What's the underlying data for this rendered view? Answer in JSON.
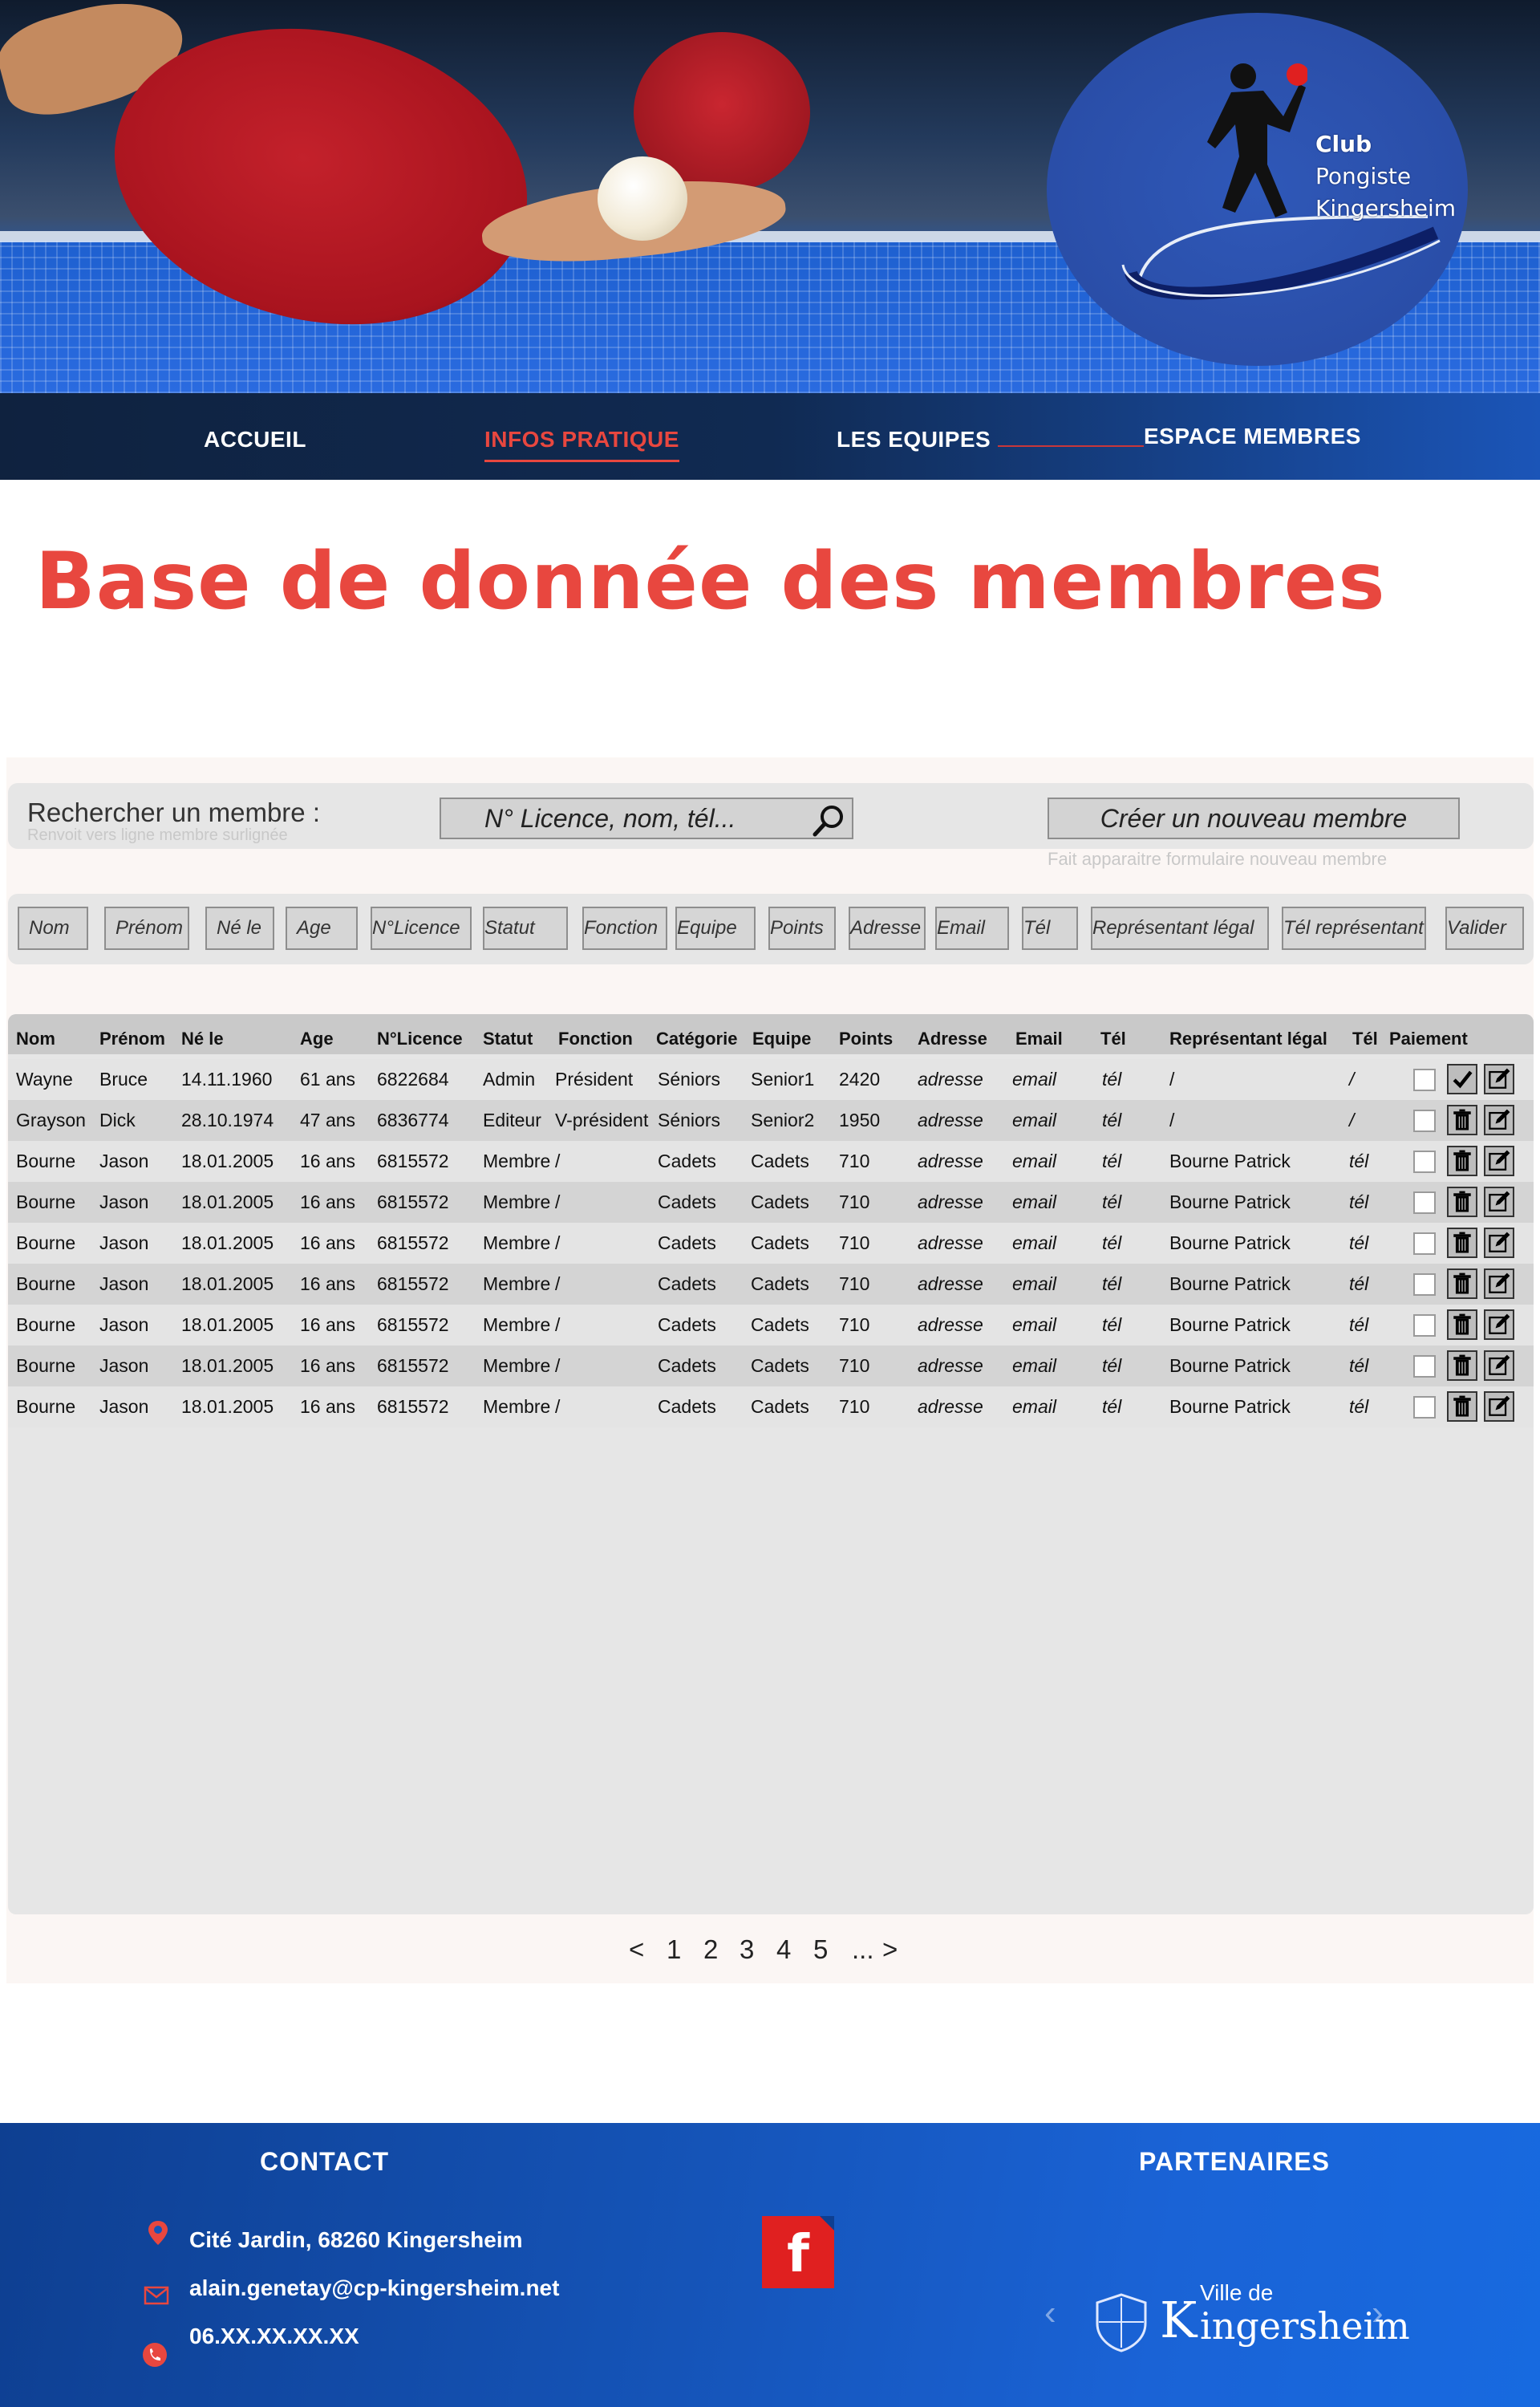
{
  "header": {
    "logo_lines": [
      "Club",
      "Pongiste",
      "Kingersheim"
    ]
  },
  "nav": {
    "items": [
      {
        "label": "ACCUEIL",
        "active": false
      },
      {
        "label": "INFOS PRATIQUE",
        "active": true
      },
      {
        "label": "LES EQUIPES",
        "active": false
      },
      {
        "label": "ESPACE MEMBRES",
        "active": false
      }
    ]
  },
  "page": {
    "title": "Base de donnée des membres"
  },
  "search": {
    "label": "Rechercher un membre :",
    "hint": "Renvoit vers ligne membre surlignée",
    "placeholder": "N° Licence, nom, tél...",
    "create_label": "Créer un nouveau membre",
    "create_hint": "Fait apparaitre formulaire nouveau membre"
  },
  "filters": [
    "Nom",
    "Prénom",
    "Né le",
    "Age",
    "N°Licence",
    "Statut",
    "Fonction",
    "Equipe",
    "Points",
    "Adresse",
    "Email",
    "Tél",
    "Représentant légal",
    "Tél représentant",
    "Valider"
  ],
  "table": {
    "headers": [
      "Nom",
      "Prénom",
      "Né le",
      "Age",
      "N°Licence",
      "Statut",
      "Fonction",
      "Catégorie",
      "Equipe",
      "Points",
      "Adresse",
      "Email",
      "Tél",
      "Représentant légal",
      "Tél",
      "Paiement"
    ],
    "rows": [
      {
        "nom": "Wayne",
        "prenom": "Bruce",
        "ne_le": "14.11.1960",
        "age": "61 ans",
        "licence": "6822684",
        "statut": "Admin",
        "fonction": "Président",
        "categorie": "Séniors",
        "equipe": "Senior1",
        "points": "2420",
        "adresse": "adresse",
        "email": "email",
        "tel": "tél",
        "representant": "/",
        "tel_rep": "/",
        "first_action": "check"
      },
      {
        "nom": "Grayson",
        "prenom": "Dick",
        "ne_le": "28.10.1974",
        "age": "47 ans",
        "licence": "6836774",
        "statut": "Editeur",
        "fonction": "V-président",
        "categorie": "Séniors",
        "equipe": "Senior2",
        "points": "1950",
        "adresse": "adresse",
        "email": "email",
        "tel": "tél",
        "representant": "/",
        "tel_rep": "/",
        "first_action": "trash"
      },
      {
        "nom": "Bourne",
        "prenom": "Jason",
        "ne_le": "18.01.2005",
        "age": "16 ans",
        "licence": "6815572",
        "statut": "Membre",
        "fonction": "/",
        "categorie": "Cadets",
        "equipe": "Cadets",
        "points": "710",
        "adresse": "adresse",
        "email": "email",
        "tel": "tél",
        "representant": "Bourne Patrick",
        "tel_rep": "tél",
        "first_action": "trash"
      },
      {
        "nom": "Bourne",
        "prenom": "Jason",
        "ne_le": "18.01.2005",
        "age": "16 ans",
        "licence": "6815572",
        "statut": "Membre",
        "fonction": "/",
        "categorie": "Cadets",
        "equipe": "Cadets",
        "points": "710",
        "adresse": "adresse",
        "email": "email",
        "tel": "tél",
        "representant": "Bourne Patrick",
        "tel_rep": "tél",
        "first_action": "trash"
      },
      {
        "nom": "Bourne",
        "prenom": "Jason",
        "ne_le": "18.01.2005",
        "age": "16 ans",
        "licence": "6815572",
        "statut": "Membre",
        "fonction": "/",
        "categorie": "Cadets",
        "equipe": "Cadets",
        "points": "710",
        "adresse": "adresse",
        "email": "email",
        "tel": "tél",
        "representant": "Bourne Patrick",
        "tel_rep": "tél",
        "first_action": "trash"
      },
      {
        "nom": "Bourne",
        "prenom": "Jason",
        "ne_le": "18.01.2005",
        "age": "16 ans",
        "licence": "6815572",
        "statut": "Membre",
        "fonction": "/",
        "categorie": "Cadets",
        "equipe": "Cadets",
        "points": "710",
        "adresse": "adresse",
        "email": "email",
        "tel": "tél",
        "representant": "Bourne Patrick",
        "tel_rep": "tél",
        "first_action": "trash"
      },
      {
        "nom": "Bourne",
        "prenom": "Jason",
        "ne_le": "18.01.2005",
        "age": "16 ans",
        "licence": "6815572",
        "statut": "Membre",
        "fonction": "/",
        "categorie": "Cadets",
        "equipe": "Cadets",
        "points": "710",
        "adresse": "adresse",
        "email": "email",
        "tel": "tél",
        "representant": "Bourne Patrick",
        "tel_rep": "tél",
        "first_action": "trash"
      },
      {
        "nom": "Bourne",
        "prenom": "Jason",
        "ne_le": "18.01.2005",
        "age": "16 ans",
        "licence": "6815572",
        "statut": "Membre",
        "fonction": "/",
        "categorie": "Cadets",
        "equipe": "Cadets",
        "points": "710",
        "adresse": "adresse",
        "email": "email",
        "tel": "tél",
        "representant": "Bourne Patrick",
        "tel_rep": "tél",
        "first_action": "trash"
      },
      {
        "nom": "Bourne",
        "prenom": "Jason",
        "ne_le": "18.01.2005",
        "age": "16 ans",
        "licence": "6815572",
        "statut": "Membre",
        "fonction": "/",
        "categorie": "Cadets",
        "equipe": "Cadets",
        "points": "710",
        "adresse": "adresse",
        "email": "email",
        "tel": "tél",
        "representant": "Bourne Patrick",
        "tel_rep": "tél",
        "first_action": "trash"
      }
    ]
  },
  "pagination": {
    "prev": "<",
    "pages": [
      "1",
      "2",
      "3",
      "4",
      "5"
    ],
    "ellipsis": "...",
    "next": ">"
  },
  "footer": {
    "contact_title": "CONTACT",
    "address": "Cité Jardin, 68260 Kingersheim",
    "email": "alain.genetay@cp-kingersheim.net",
    "phone": "06.XX.XX.XX.XX",
    "partners_title": "PARTENAIRES",
    "partner_logo": {
      "prefix": "Ville de",
      "initial": "K",
      "rest": "ingersheim"
    },
    "facebook_glyph": "f"
  },
  "colors": {
    "accent_red": "#e8473f",
    "nav_dark": "#0f223f",
    "footer_blue": "#1554b8",
    "table_bg": "#e6e6e6"
  },
  "icons": [
    "search-icon",
    "checkmark-icon",
    "trash-icon",
    "edit-icon",
    "location-pin-icon",
    "mail-icon",
    "phone-icon",
    "facebook-icon",
    "chevron-left-icon",
    "chevron-right-icon"
  ]
}
